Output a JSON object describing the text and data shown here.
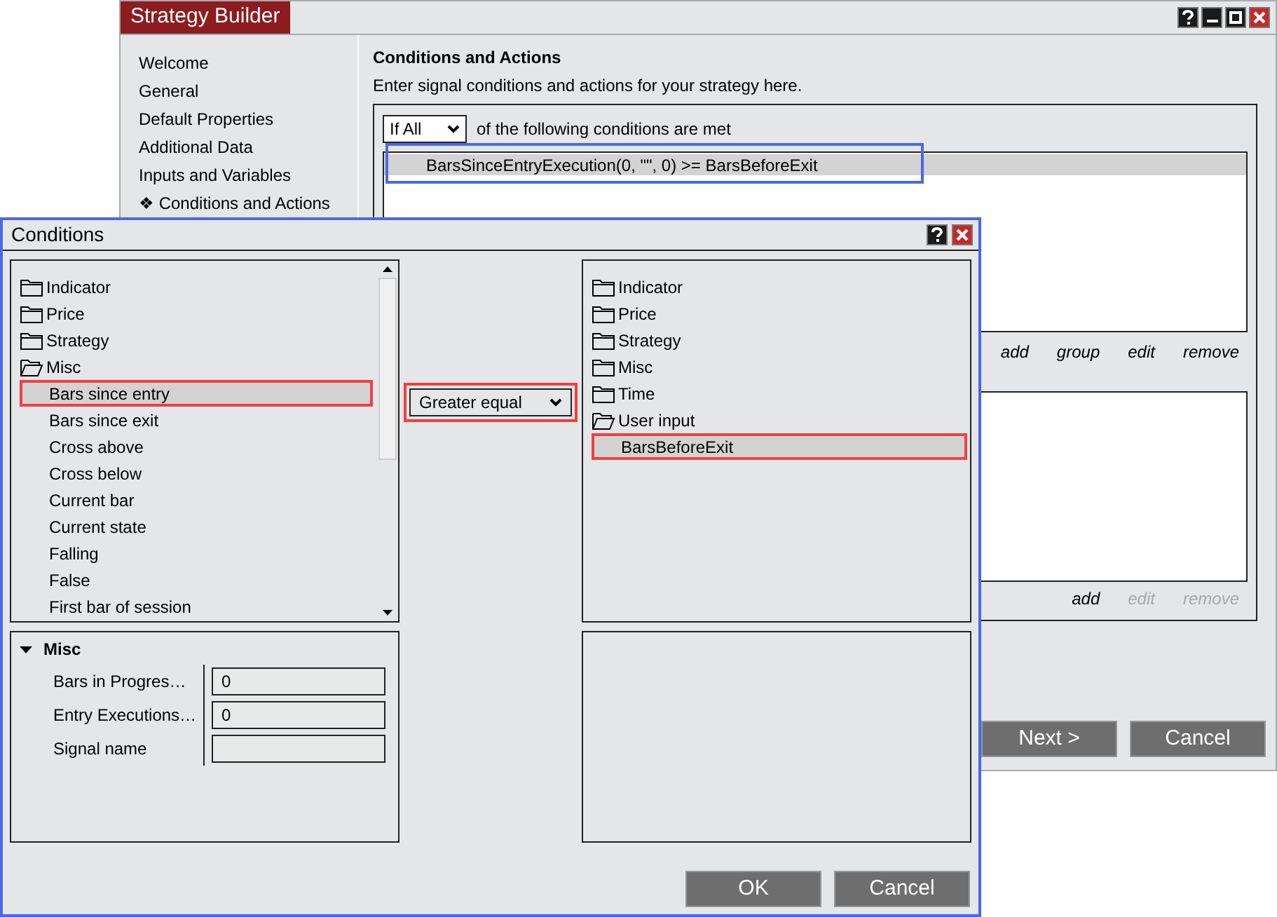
{
  "builder": {
    "title": "Strategy Builder",
    "sidebar": {
      "items": [
        {
          "label": "Welcome"
        },
        {
          "label": "General"
        },
        {
          "label": "Default Properties"
        },
        {
          "label": "Additional Data"
        },
        {
          "label": "Inputs and Variables"
        },
        {
          "label": "❖ Conditions and Actions"
        }
      ]
    },
    "heading": "Conditions and Actions",
    "description": "Enter signal conditions and actions for your strategy here.",
    "match_dropdown": {
      "value": "If All"
    },
    "match_text": "of the following conditions are met",
    "conditions": [
      {
        "text": "BarsSinceEntryExecution(0, \"\", 0) >= BarsBeforeExit",
        "selected": true,
        "highlighted": true
      }
    ],
    "condition_links": [
      {
        "label": "add",
        "disabled": false
      },
      {
        "label": "group",
        "disabled": false
      },
      {
        "label": "edit",
        "disabled": false
      },
      {
        "label": "remove",
        "disabled": false
      }
    ],
    "action_links": [
      {
        "label": "add",
        "disabled": false
      },
      {
        "label": "edit",
        "disabled": true
      },
      {
        "label": "remove",
        "disabled": true
      }
    ],
    "buttons": [
      "Next >",
      "Cancel"
    ]
  },
  "dialog": {
    "title": "Conditions",
    "left_tree": [
      {
        "label": "Indicator",
        "expanded": false
      },
      {
        "label": "Price",
        "expanded": false
      },
      {
        "label": "Strategy",
        "expanded": false
      },
      {
        "label": "Misc",
        "expanded": true,
        "children": [
          {
            "label": "Bars since entry",
            "selected": true
          },
          {
            "label": "Bars since exit",
            "selected": false
          },
          {
            "label": "Cross above",
            "selected": false
          },
          {
            "label": "Cross below",
            "selected": false
          },
          {
            "label": "Current bar",
            "selected": false
          },
          {
            "label": "Current state",
            "selected": false
          },
          {
            "label": "Falling",
            "selected": false
          },
          {
            "label": "False",
            "selected": false
          },
          {
            "label": "First bar of session",
            "selected": false
          }
        ]
      }
    ],
    "operator": {
      "value": "Greater equal",
      "highlighted": true
    },
    "right_tree": [
      {
        "label": "Indicator",
        "expanded": false
      },
      {
        "label": "Price",
        "expanded": false
      },
      {
        "label": "Strategy",
        "expanded": false
      },
      {
        "label": "Misc",
        "expanded": false
      },
      {
        "label": "Time",
        "expanded": false
      },
      {
        "label": "User input",
        "expanded": true,
        "children": [
          {
            "label": "BarsBeforeExit",
            "selected": true
          }
        ]
      }
    ],
    "properties": {
      "group": "Misc",
      "expanded": true,
      "rows": [
        {
          "name": "Bars in Progres…",
          "value": "0"
        },
        {
          "name": "Entry Executions…",
          "value": "0"
        },
        {
          "name": "Signal name",
          "value": ""
        }
      ]
    },
    "buttons": [
      "OK",
      "Cancel"
    ]
  }
}
